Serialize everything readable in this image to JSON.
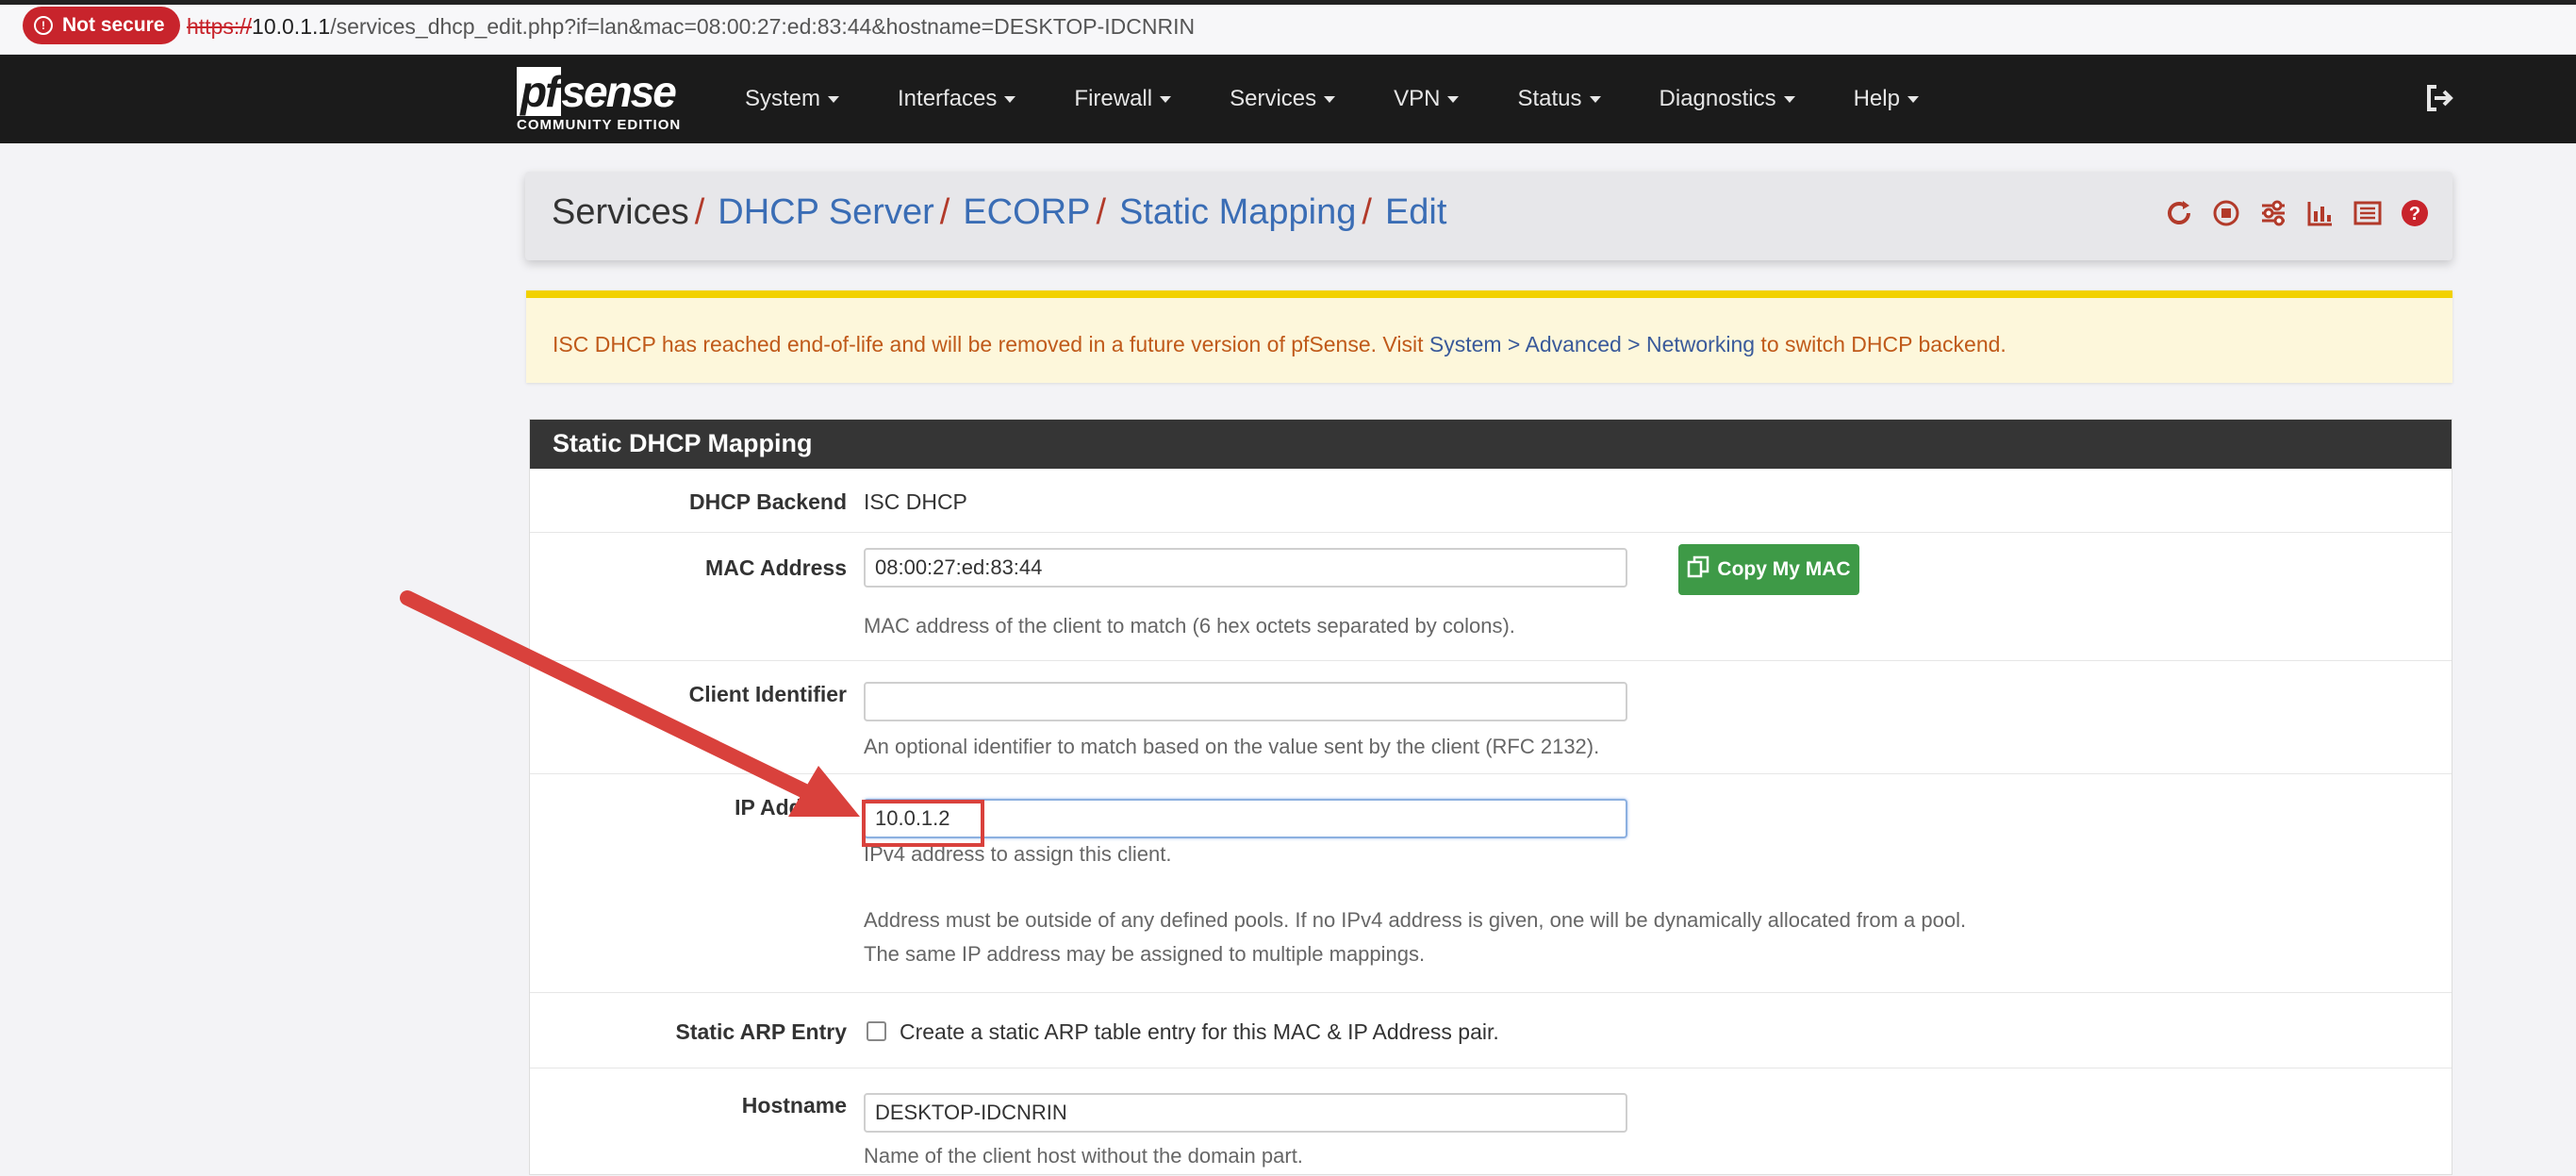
{
  "browser": {
    "security_label": "Not secure",
    "url_scheme": "https://",
    "url_host": "10.0.1.1",
    "url_path": "/services_dhcp_edit.php?if=lan&mac=08:00:27:ed:83:44&hostname=DESKTOP-IDCNRIN"
  },
  "navbar": {
    "logo_text": "pfsense",
    "logo_sub": "COMMUNITY EDITION",
    "items": [
      {
        "label": "System"
      },
      {
        "label": "Interfaces"
      },
      {
        "label": "Firewall"
      },
      {
        "label": "Services"
      },
      {
        "label": "VPN"
      },
      {
        "label": "Status"
      },
      {
        "label": "Diagnostics"
      },
      {
        "label": "Help"
      }
    ]
  },
  "breadcrumb": {
    "items": [
      "Services",
      "DHCP Server",
      "ECORP",
      "Static Mapping",
      "Edit"
    ],
    "separator": "/"
  },
  "alert": {
    "text_before": "ISC DHCP has reached end-of-life and will be removed in a future version of pfSense. Visit ",
    "link": "System > Advanced > Networking",
    "text_after": " to switch DHCP backend."
  },
  "panel": {
    "title": "Static DHCP Mapping",
    "dhcp_backend": {
      "label": "DHCP Backend",
      "value": "ISC DHCP"
    },
    "mac_address": {
      "label": "MAC Address",
      "value": "08:00:27:ed:83:44",
      "help": "MAC address of the client to match (6 hex octets separated by colons).",
      "button": "Copy My MAC"
    },
    "client_identifier": {
      "label": "Client Identifier",
      "value": "",
      "help": "An optional identifier to match based on the value sent by the client (RFC 2132)."
    },
    "ip_address": {
      "label": "IP Address",
      "value": "10.0.1.2",
      "help1": "IPv4 address to assign this client.",
      "help2": "Address must be outside of any defined pools. If no IPv4 address is given, one will be dynamically allocated from a pool.",
      "help3": "The same IP address may be assigned to multiple mappings."
    },
    "static_arp": {
      "label": "Static ARP Entry",
      "checkbox_label": "Create a static ARP table entry for this MAC & IP Address pair.",
      "checked": false
    },
    "hostname": {
      "label": "Hostname",
      "value": "DESKTOP-IDCNRIN",
      "help": "Name of the client host without the domain part."
    }
  },
  "colors": {
    "navbar_bg": "#1b1b1b",
    "link_blue": "#3a6db5",
    "button_green": "#3e9a47",
    "annotation_red": "#d9413c",
    "alert_bg": "#fdf7db"
  },
  "icons": [
    "reload-icon",
    "stop-icon",
    "settings-sliders-icon",
    "chart-icon",
    "log-list-icon",
    "help-icon",
    "logout-icon",
    "copy-icon",
    "warning-circle-icon"
  ]
}
